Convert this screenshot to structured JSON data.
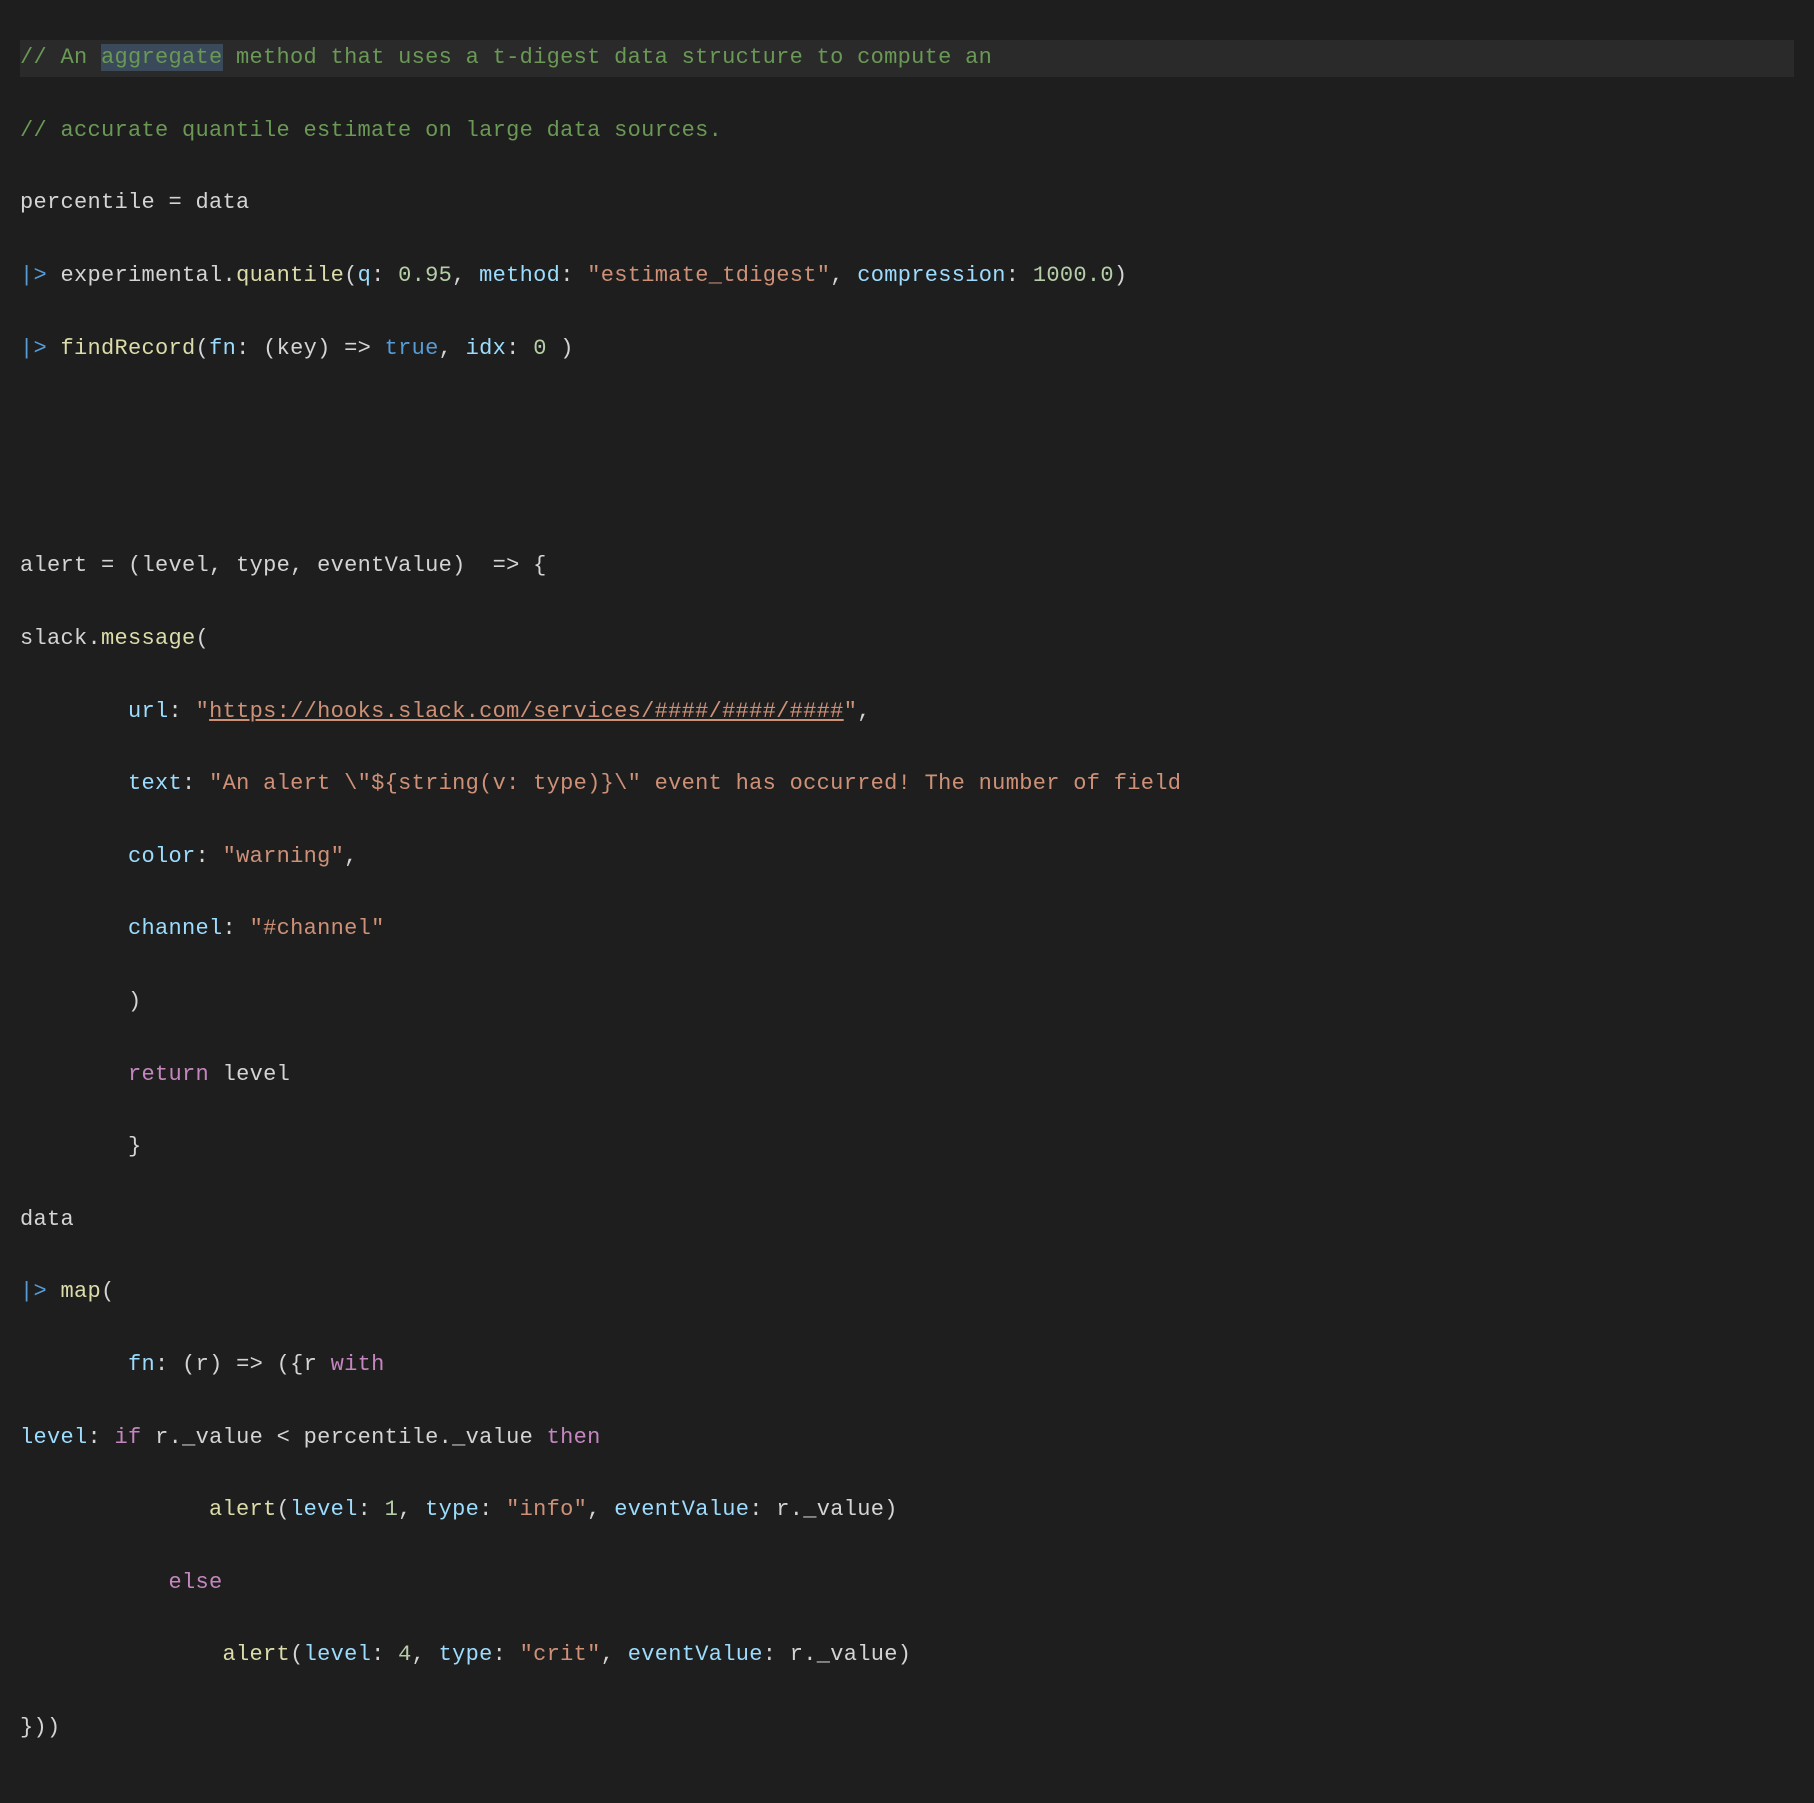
{
  "code": {
    "line1": {
      "prefix": "// An ",
      "highlighted": "aggregate",
      "suffix": " method that uses a t-digest data structure to compute an"
    },
    "line2": "// accurate quantile estimate on large data sources.",
    "line3": {
      "var": "percentile",
      "eq": " = ",
      "data": "data"
    },
    "line4": {
      "pipe": "|> ",
      "ns": "experimental",
      "dot": ".",
      "fn": "quantile",
      "open": "(",
      "p1k": "q",
      "p1c": ": ",
      "p1v": "0.95",
      "c1": ", ",
      "p2k": "method",
      "p2c": ": ",
      "p2v": "\"estimate_tdigest\"",
      "c2": ", ",
      "p3k": "compression",
      "p3c": ": ",
      "p3v": "1000.0",
      "close": ")"
    },
    "line5": {
      "pipe": "|> ",
      "fn": "findRecord",
      "open": "(",
      "p1k": "fn",
      "p1c": ": (",
      "p1arg": "key",
      "p1arrow": ") => ",
      "p1v": "true",
      "c1": ", ",
      "p2k": "idx",
      "p2c": ": ",
      "p2v": "0",
      "close": " )"
    },
    "line8": {
      "var": "alert",
      "eq": " = (",
      "a1": "level",
      "c1": ", ",
      "a2": "type",
      "c2": ", ",
      "a3": "eventValue",
      "close": ")  => {"
    },
    "line9": {
      "ns": "slack",
      "dot": ".",
      "fn": "message",
      "open": "("
    },
    "line10": {
      "indent": "        ",
      "key": "url",
      "colon": ": ",
      "q1": "\"",
      "url": "https://hooks.slack.com/services/####/####/####",
      "q2": "\"",
      "comma": ","
    },
    "line11": {
      "indent": "        ",
      "key": "text",
      "colon": ": ",
      "val": "\"An alert \\\"${string(v: type)}\\\" event has occurred! The number of field"
    },
    "line12": {
      "indent": "        ",
      "key": "color",
      "colon": ": ",
      "val": "\"warning\"",
      "comma": ","
    },
    "line13": {
      "indent": "        ",
      "key": "channel",
      "colon": ": ",
      "val": "\"#channel\""
    },
    "line14": {
      "indent": "        ",
      "close": ")"
    },
    "line15": {
      "indent": "        ",
      "ret": "return",
      "sp": " ",
      "val": "level"
    },
    "line16": {
      "indent": "        ",
      "close": "}"
    },
    "line17": "data",
    "line18": {
      "pipe": "|> ",
      "fn": "map",
      "open": "("
    },
    "line19": {
      "indent": "        ",
      "key": "fn",
      "colon": ": (",
      "arg": "r",
      "arrow": ") => ({",
      "r": "r",
      "with": " with"
    },
    "line20": {
      "key": "level",
      "colon": ": ",
      "if": "if",
      "sp1": " ",
      "lhs": "r._value",
      "op": " < ",
      "rhs": "percentile._value",
      "sp2": " ",
      "then": "then"
    },
    "line21": {
      "indent": "              ",
      "fn": "alert",
      "open": "(",
      "p1k": "level",
      "p1c": ": ",
      "p1v": "1",
      "c1": ", ",
      "p2k": "type",
      "p2c": ": ",
      "p2v": "\"info\"",
      "c2": ", ",
      "p3k": "eventValue",
      "p3c": ": ",
      "p3v": "r._value",
      "close": ")"
    },
    "line22": {
      "indent": "           ",
      "else": "else"
    },
    "line23": {
      "indent": "               ",
      "fn": "alert",
      "open": "(",
      "p1k": "level",
      "p1c": ": ",
      "p1v": "4",
      "c1": ", ",
      "p2k": "type",
      "p2c": ": ",
      "p2v": "\"crit\"",
      "c2": ", ",
      "p3k": "eventValue",
      "p3c": ": ",
      "p3v": "r._value",
      "close": ")"
    },
    "line24": "}))"
  }
}
